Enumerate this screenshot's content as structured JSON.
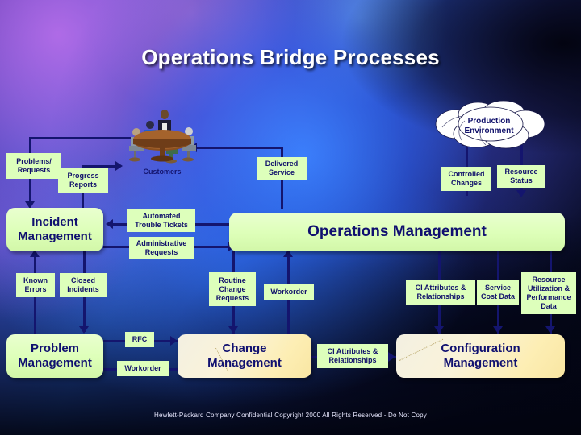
{
  "slide": {
    "title": "Operations Bridge Processes",
    "footer": "Hewlett-Packard Company Confidential Copyright 2000 All Rights Reserved - Do Not Copy"
  },
  "colors": {
    "label_fill": "#ddffbb",
    "label_text": "#11116b",
    "process_green": "#ddffb8",
    "process_cream": "#faf3d9",
    "arrow": "#14156e",
    "title_text": "#ffffff"
  },
  "clipart": {
    "customers_caption": "Customers"
  },
  "cloud": {
    "line1": "Production",
    "line2": "Environment"
  },
  "processes": [
    {
      "id": "incident",
      "label": "Incident\nManagement",
      "line1": "Incident",
      "line2": "Management",
      "style": "green"
    },
    {
      "id": "operations",
      "label": "Operations Management",
      "line1": "Operations Management",
      "line2": "",
      "style": "green"
    },
    {
      "id": "problem",
      "label": "Problem\nManagement",
      "line1": "Problem",
      "line2": "Management",
      "style": "green"
    },
    {
      "id": "change",
      "label": "Change\nManagement",
      "line1": "Change",
      "line2": "Management",
      "style": "cream"
    },
    {
      "id": "configuration",
      "label": "Configuration\nManagement",
      "line1": "Configuration",
      "line2": "Management",
      "style": "cream"
    }
  ],
  "flows": {
    "problems_requests": "Problems/\nRequests",
    "problems_requests_l1": "Problems/",
    "problems_requests_l2": "Requests",
    "progress_reports_l1": "Progress",
    "progress_reports_l2": "Reports",
    "delivered_service_l1": "Delivered",
    "delivered_service_l2": "Service",
    "controlled_changes_l1": "Controlled",
    "controlled_changes_l2": "Changes",
    "resource_status_l1": "Resource",
    "resource_status_l2": "Status",
    "automated_trouble_tickets_l1": "Automated",
    "automated_trouble_tickets_l2": "Trouble Tickets",
    "administrative_requests_l1": "Administrative",
    "administrative_requests_l2": "Requests",
    "known_errors_l1": "Known",
    "known_errors_l2": "Errors",
    "closed_incidents_l1": "Closed",
    "closed_incidents_l2": "Incidents",
    "routine_change_requests_l1": "Routine",
    "routine_change_requests_l2": "Change",
    "routine_change_requests_l3": "Requests",
    "workorder_top": "Workorder",
    "ci_attributes_top_l1": "CI Attributes &",
    "ci_attributes_top_l2": "Relationships",
    "service_cost_data_l1": "Service",
    "service_cost_data_l2": "Cost Data",
    "resource_utilization_l1": "Resource",
    "resource_utilization_l2": "Utilization &",
    "resource_utilization_l3": "Performance",
    "resource_utilization_l4": "Data",
    "rfc": "RFC",
    "workorder_bottom": "Workorder",
    "ci_attributes_mid_l1": "CI Attributes &",
    "ci_attributes_mid_l2": "Relationships"
  }
}
